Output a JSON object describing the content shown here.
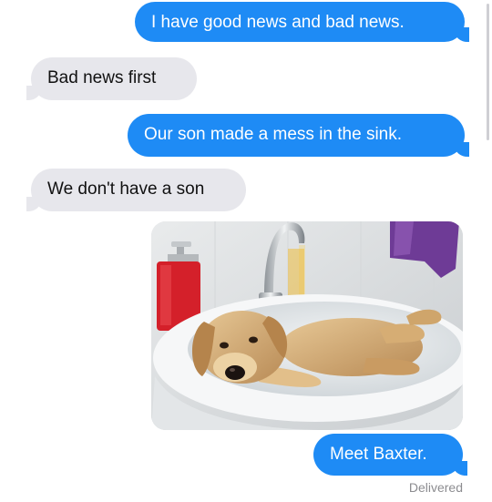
{
  "messages": [
    {
      "direction": "sent",
      "text": "I have good news and bad news."
    },
    {
      "direction": "received",
      "text": "Bad news first"
    },
    {
      "direction": "sent",
      "text": "Our son made a mess in the sink."
    },
    {
      "direction": "received",
      "text": "We don't have a son"
    },
    {
      "direction": "sent",
      "type": "photo",
      "content": "golden retriever puppy lying in a bathroom sink"
    },
    {
      "direction": "sent",
      "text": "Meet Baxter."
    }
  ],
  "status": "Delivered",
  "colors": {
    "sent_bubble": "#1e8bf5",
    "received_bubble": "#e7e7ec",
    "sent_text": "#ffffff",
    "received_text": "#111111",
    "status_text": "#8c8c90"
  }
}
